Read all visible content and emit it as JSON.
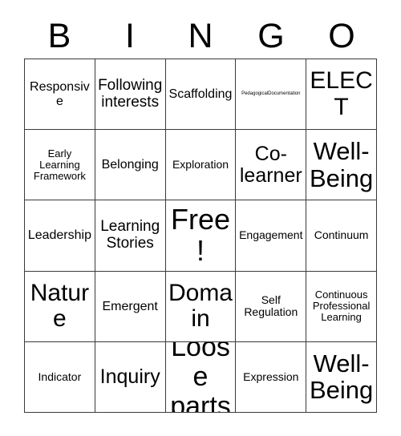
{
  "card": {
    "header_letters": [
      "B",
      "I",
      "N",
      "G",
      "O"
    ],
    "colors": {
      "background": "#ffffff",
      "text": "#000000",
      "grid_line": "#3a3a3a"
    },
    "grid": {
      "rows": 5,
      "columns": 5,
      "cells": [
        {
          "text": "Responsive",
          "size": "fs-m"
        },
        {
          "text": "Following interests",
          "size": "fs-l"
        },
        {
          "text": "Scaffolding",
          "size": "fs-m"
        },
        {
          "text": "PedagogicalDocumentation",
          "size": "fs-xxs"
        },
        {
          "text": "ELECT",
          "size": "fs-xxl"
        },
        {
          "text": "Early Learning Framework",
          "size": "fs-xs"
        },
        {
          "text": "Belonging",
          "size": "fs-m"
        },
        {
          "text": "Exploration",
          "size": "fs-s"
        },
        {
          "text": "Co-learner",
          "size": "fs-xl"
        },
        {
          "text": "Well-Being",
          "size": "fs-3xl"
        },
        {
          "text": "Leadership",
          "size": "fs-m"
        },
        {
          "text": "Learning Stories",
          "size": "fs-l"
        },
        {
          "text": "Free!",
          "size": "fs-free"
        },
        {
          "text": "Engagement",
          "size": "fs-s"
        },
        {
          "text": "Continuum",
          "size": "fs-s"
        },
        {
          "text": "Nature",
          "size": "fs-xxl"
        },
        {
          "text": "Emergent",
          "size": "fs-m"
        },
        {
          "text": "Domain",
          "size": "fs-xxl"
        },
        {
          "text": "Self Regulation",
          "size": "fs-s"
        },
        {
          "text": "Continuous Professional Learning",
          "size": "fs-xs"
        },
        {
          "text": "Indicator",
          "size": "fs-s"
        },
        {
          "text": "Inquiry",
          "size": "fs-xl"
        },
        {
          "text": "Loose parts",
          "size": "fs-4xl"
        },
        {
          "text": "Expression",
          "size": "fs-s"
        },
        {
          "text": "Well-Being",
          "size": "fs-3xl"
        }
      ]
    }
  }
}
